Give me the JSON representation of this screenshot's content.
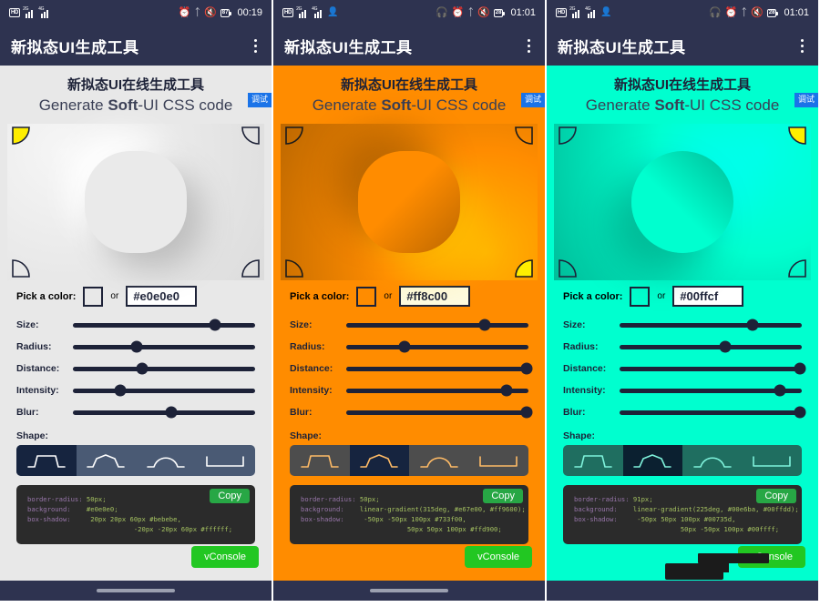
{
  "panels": [
    {
      "id": "panel-gray",
      "status": {
        "hd": "HD",
        "net1": "2G",
        "net2": "4G",
        "battery": "87",
        "time": "00:19",
        "icons": [
          "hd-icon",
          "signal-icon",
          "signal-icon",
          "alarm-icon",
          "bluetooth-icon",
          "mute-icon",
          "battery-icon"
        ]
      },
      "appbar": {
        "title": "新拟态UI生成工具",
        "menu": "overflow-menu"
      },
      "titles": {
        "line1": "新拟态UI在线生成工具",
        "line2_pre": "Generate ",
        "line2_bold": "Soft",
        "line2_post": "-UI CSS code"
      },
      "light_corner": "top-left",
      "preview": {
        "bg_color": "#e8e8e8",
        "shape_fill": "#e8e8e8",
        "shape_radius": "50px",
        "shadow_dark": "#bebebe",
        "shadow_light": "#ffffff"
      },
      "color": {
        "label": "Pick a color:",
        "or": "or",
        "hex": "#e0e0e0",
        "swatch": "#e8e8e8"
      },
      "debug_label": "调试",
      "sliders": [
        {
          "label": "Size:",
          "value": 78
        },
        {
          "label": "Radius:",
          "value": 35
        },
        {
          "label": "Distance:",
          "value": 38
        },
        {
          "label": "Intensity:",
          "value": 26
        },
        {
          "label": "Blur:",
          "value": 54
        }
      ],
      "shape": {
        "label": "Shape:",
        "selected": 0,
        "options": [
          "flat-raised",
          "pressed-dip",
          "convex",
          "concave"
        ]
      },
      "code": {
        "copy_label": "Copy",
        "lines": [
          {
            "key": "border-radius:",
            "value": " 50px;"
          },
          {
            "key": "background:",
            "value": " #e0e0e0;"
          },
          {
            "key": "box-shadow:",
            "value": "  20px 20px 60px #bebebe,"
          },
          {
            "key": "",
            "value": "             -20px -20px 60px #ffffff;"
          }
        ]
      },
      "vconsole_label": "vConsole",
      "has_finger": false
    },
    {
      "id": "panel-orange",
      "status": {
        "hd": "HD",
        "net1": "2G",
        "net2": "4G",
        "battery": "28",
        "time": "01:01",
        "icons": [
          "hd-icon",
          "signal-icon",
          "signal-icon",
          "person-icon",
          "headphone-icon",
          "alarm-icon",
          "bluetooth-icon",
          "mute-icon",
          "battery-icon"
        ]
      },
      "appbar": {
        "title": "新拟态UI生成工具",
        "menu": "overflow-menu"
      },
      "titles": {
        "line1": "新拟态UI在线生成工具",
        "line2_pre": "Generate ",
        "line2_bold": "Soft",
        "line2_post": "-UI CSS code"
      },
      "light_corner": "bottom-right",
      "preview": {
        "bg_color": "#ff8c00",
        "shape_fill": "#ff8c00",
        "shape_radius": "50px",
        "shadow_dark": "#733f00",
        "shadow_light": "#ffd900"
      },
      "color": {
        "label": "Pick a color:",
        "or": "or",
        "hex": "#ff8c00",
        "swatch": "#ff8c00"
      },
      "debug_label": "调试",
      "sliders": [
        {
          "label": "Size:",
          "value": 76
        },
        {
          "label": "Radius:",
          "value": 32
        },
        {
          "label": "Distance:",
          "value": 99
        },
        {
          "label": "Intensity:",
          "value": 88
        },
        {
          "label": "Blur:",
          "value": 99
        }
      ],
      "shape": {
        "label": "Shape:",
        "selected": 1,
        "options": [
          "flat-raised",
          "pressed-dip",
          "convex",
          "concave"
        ]
      },
      "code": {
        "copy_label": "Copy",
        "lines": [
          {
            "key": "border-radius:",
            "value": " 50px;"
          },
          {
            "key": "background:",
            "value": " linear-gradient(315deg, #e67e00, #ff9600);"
          },
          {
            "key": "box-shadow:",
            "value": "  -50px -50px 100px #733f00,"
          },
          {
            "key": "",
            "value": "             50px 50px 100px #ffd900;"
          }
        ]
      },
      "vconsole_label": "vConsole",
      "has_finger": false
    },
    {
      "id": "panel-teal",
      "status": {
        "hd": "HD",
        "net1": "2G",
        "net2": "4G",
        "battery": "28",
        "time": "01:01",
        "icons": [
          "hd-icon",
          "signal-icon",
          "signal-icon",
          "person-icon",
          "headphone-icon",
          "alarm-icon",
          "bluetooth-icon",
          "mute-icon",
          "battery-icon"
        ]
      },
      "appbar": {
        "title": "新拟态UI生成工具",
        "menu": "overflow-menu"
      },
      "titles": {
        "line1": "新拟态UI在线生成工具",
        "line2_pre": "Generate ",
        "line2_bold": "Soft",
        "line2_post": "-UI CSS code"
      },
      "light_corner": "top-right",
      "preview": {
        "bg_color": "#00ffcf",
        "shape_fill": "#00ffcf",
        "shape_radius": "91px",
        "shadow_dark": "#00735d",
        "shadow_light": "#00ffff"
      },
      "color": {
        "label": "Pick a color:",
        "or": "or",
        "hex": "#00ffcf",
        "swatch": "#00ffcf"
      },
      "debug_label": "调试",
      "sliders": [
        {
          "label": "Size:",
          "value": 73
        },
        {
          "label": "Radius:",
          "value": 58
        },
        {
          "label": "Distance:",
          "value": 99
        },
        {
          "label": "Intensity:",
          "value": 88
        },
        {
          "label": "Blur:",
          "value": 99
        }
      ],
      "shape": {
        "label": "Shape:",
        "selected": 1,
        "options": [
          "flat-raised",
          "pressed-dip",
          "convex",
          "concave"
        ]
      },
      "code": {
        "copy_label": "Copy",
        "lines": [
          {
            "key": "border-radius:",
            "value": " 91px;"
          },
          {
            "key": "background:",
            "value": " linear-gradient(225deg, #00e6ba, #00ffdd);"
          },
          {
            "key": "box-shadow:",
            "value": "  -50px 50px 100px #00735d,"
          },
          {
            "key": "",
            "value": "             50px -50px 100px #00ffff;"
          }
        ]
      },
      "vconsole_label": "vConsole",
      "has_finger": true
    }
  ],
  "theme": {
    "dark_navy": "#2e3350",
    "ink": "#1d2238",
    "accent_yellow": "#ffee00",
    "copy_green": "#27a745",
    "vconsole_green": "#22c722",
    "debug_blue": "#1a73e8"
  }
}
